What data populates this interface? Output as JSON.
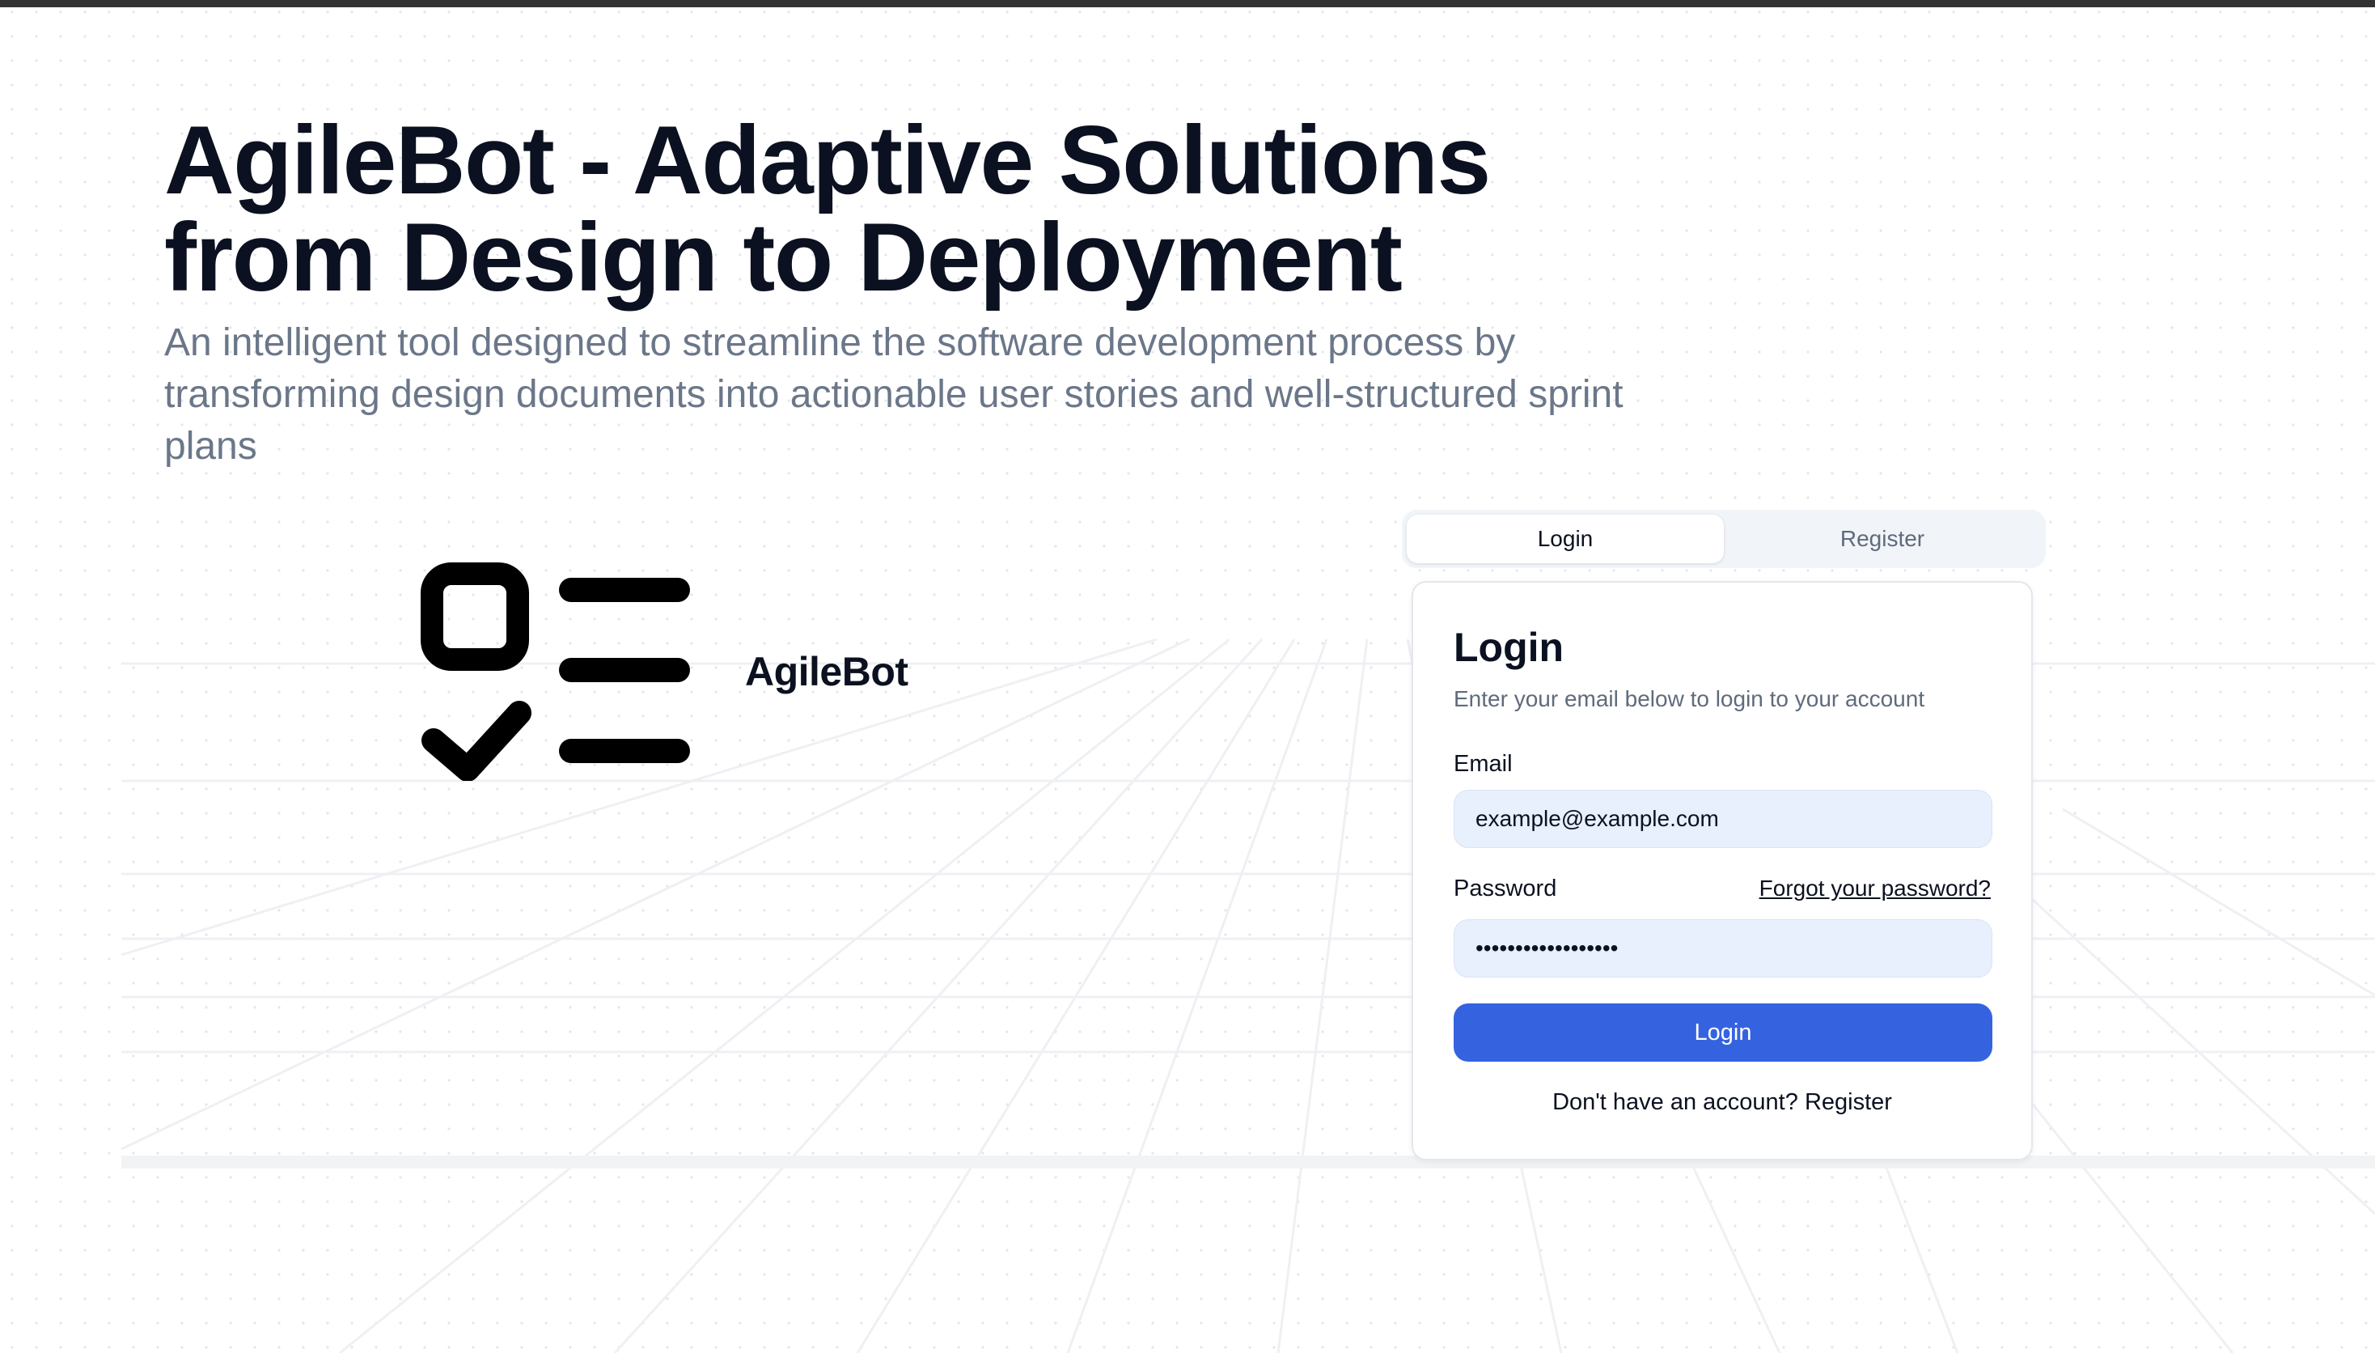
{
  "hero": {
    "title_line1": "AgileBot - Adaptive Solutions",
    "title_line2": "from Design to Deployment",
    "subtitle": "An intelligent tool designed to streamline the software development process by transforming design documents into actionable user stories and well-structured sprint plans"
  },
  "brand": {
    "name": "AgileBot",
    "logo_icon": "checklist-icon"
  },
  "auth_tabs": {
    "login": "Login",
    "register": "Register",
    "active": "login"
  },
  "login_card": {
    "title": "Login",
    "subtitle": "Enter your email below to login to your account",
    "email_label": "Email",
    "email_value": "example@example.com",
    "password_label": "Password",
    "password_value": "••••••••••••••••••",
    "forgot_link": "Forgot your password?",
    "submit_label": "Login",
    "register_prompt": "Don't have an account?",
    "register_link": "Register"
  },
  "colors": {
    "primary": "#3563e0",
    "heading": "#0b1120",
    "muted": "#6b7789",
    "input_bg": "#e8effd",
    "top_bar": "#333333"
  }
}
